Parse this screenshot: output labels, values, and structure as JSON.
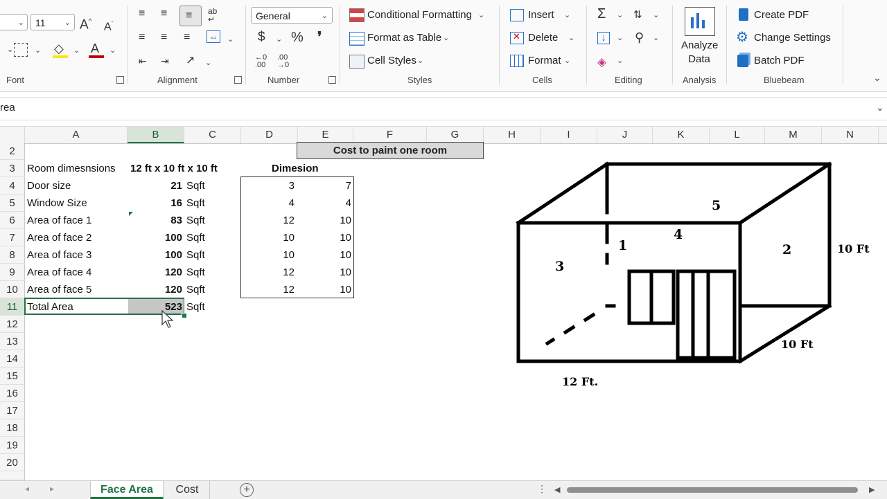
{
  "ribbon": {
    "font": {
      "size": "11",
      "label": "Font"
    },
    "alignment": {
      "label": "Alignment",
      "wrap_glyph": "ab"
    },
    "number": {
      "format": "General",
      "label": "Number",
      "currency": "$",
      "percent": "%",
      "comma": "❜",
      "inc_decimal": "←0\n.00",
      "dec_decimal": ".00\n→0"
    },
    "styles": {
      "conditional_formatting": "Conditional Formatting",
      "format_as_table": "Format as Table",
      "cell_styles": "Cell Styles",
      "label": "Styles"
    },
    "cells": {
      "insert": "Insert",
      "delete": "Delete",
      "format": "Format",
      "label": "Cells"
    },
    "editing": {
      "label": "Editing",
      "sum": "Σ"
    },
    "analysis": {
      "analyze_line1": "Analyze",
      "analyze_line2": "Data",
      "label": "Analysis"
    },
    "bluebeam": {
      "create_pdf": "Create PDF",
      "change_settings": "Change Settings",
      "batch_pdf": "Batch PDF",
      "label": "Bluebeam"
    }
  },
  "formula_bar": {
    "name_box": "rea"
  },
  "columns": [
    "A",
    "B",
    "C",
    "D",
    "E",
    "F",
    "G",
    "H",
    "I",
    "J",
    "K",
    "L",
    "M",
    "N"
  ],
  "rows": [
    "2",
    "3",
    "4",
    "5",
    "6",
    "7",
    "8",
    "9",
    "10",
    "11",
    "12",
    "13",
    "14",
    "15",
    "16",
    "17",
    "18",
    "19",
    "20"
  ],
  "sheet": {
    "title": "Cost to paint one room",
    "room_label": "Room dimesnsions",
    "room_value": "12 ft x 10 ft x 10 ft",
    "dimension_header": "Dimesion",
    "items": [
      {
        "label": "Door size",
        "value": "21",
        "unit": "Sqft"
      },
      {
        "label": "Window Size",
        "value": "16",
        "unit": "Sqft"
      },
      {
        "label": "Area of face 1",
        "value": "83",
        "unit": "Sqft"
      },
      {
        "label": "Area of face 2",
        "value": "100",
        "unit": "Sqft"
      },
      {
        "label": "Area of face 3",
        "value": "100",
        "unit": "Sqft"
      },
      {
        "label": "Area of face 4",
        "value": "120",
        "unit": "Sqft"
      },
      {
        "label": "Area of face 5",
        "value": "120",
        "unit": "Sqft"
      }
    ],
    "dims": [
      [
        "3",
        "7"
      ],
      [
        "4",
        "4"
      ],
      [
        "12",
        "10"
      ],
      [
        "10",
        "10"
      ],
      [
        "10",
        "10"
      ],
      [
        "12",
        "10"
      ],
      [
        "12",
        "10"
      ]
    ],
    "total_label": "Total Area",
    "total_value": "523",
    "total_unit": "Sqft"
  },
  "diagram": {
    "face1": "1",
    "face2": "2",
    "face3": "3",
    "face4": "4",
    "face5": "5",
    "height": "10 Ft",
    "depth": "10 Ft",
    "width": "12 Ft."
  },
  "tabs": [
    {
      "label": "Face Area",
      "active": true
    },
    {
      "label": "Cost",
      "active": false
    }
  ],
  "colors": {
    "accent": "#217346",
    "selection": "#c6c6c6"
  }
}
